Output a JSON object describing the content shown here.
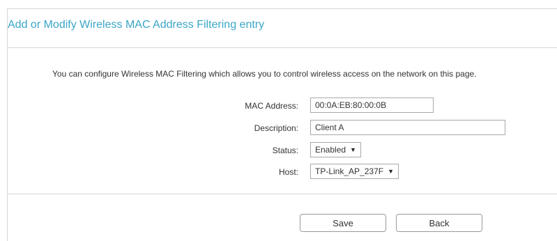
{
  "panel": {
    "title": "Add or Modify Wireless MAC Address Filtering entry",
    "intro": "You can configure Wireless MAC Filtering which allows you to control wireless access on the network on this page."
  },
  "form": {
    "mac_address": {
      "label": "MAC Address:",
      "value": "00:0A:EB:80:00:0B"
    },
    "description": {
      "label": "Description:",
      "value": "Client A"
    },
    "status": {
      "label": "Status:",
      "selected": "Enabled"
    },
    "host": {
      "label": "Host:",
      "selected": "TP-Link_AP_237F"
    }
  },
  "actions": {
    "save_label": "Save",
    "back_label": "Back"
  },
  "icons": {
    "dropdown_caret": "chevron-down-icon"
  },
  "colors": {
    "title": "#3aa6c8",
    "border": "#d6d6d6"
  }
}
